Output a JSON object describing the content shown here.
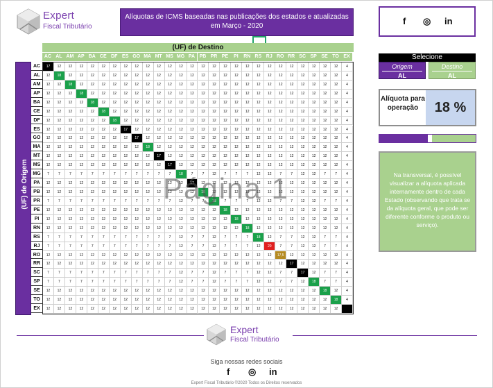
{
  "header": {
    "logo_title": "Expert",
    "logo_subtitle": "Fiscal Tributário",
    "title": "Alíquotas de ICMS baseadas nas publicações dos estados e atualizadas em Março - 2020"
  },
  "social": {
    "facebook": "f",
    "instagram": "◎",
    "linkedin": "in"
  },
  "table": {
    "dest_label": "(UF) de Destino",
    "orig_label": "(UF) de Origem",
    "states": [
      "AC",
      "AL",
      "AM",
      "AP",
      "BA",
      "CE",
      "DF",
      "ES",
      "GO",
      "MA",
      "MT",
      "MS",
      "MG",
      "PA",
      "PB",
      "PR",
      "PE",
      "PI",
      "RN",
      "RS",
      "RJ",
      "RO",
      "RR",
      "SC",
      "SP",
      "SE",
      "TO",
      "EX"
    ],
    "default_value": "12",
    "south_value": "7",
    "ex_value": "4",
    "diag_values": [
      "17",
      "18",
      "18",
      "18",
      "18",
      "18",
      "18",
      "17",
      "17",
      "18",
      "17",
      "17",
      "18",
      "17",
      "18",
      "18",
      "18",
      "18",
      "18",
      "18",
      "20",
      "17,5",
      "17",
      "17",
      "18",
      "18",
      "18",
      ""
    ],
    "south_rows": [
      "MG",
      "PR",
      "RS",
      "RJ",
      "SC",
      "SP"
    ],
    "watermark": "Página 1"
  },
  "panel": {
    "select_label": "Selecione",
    "origem_label": "Origem",
    "destino_label": "Destino",
    "origem_value": "AL",
    "destino_value": "AL",
    "aliquota_label": "Alíquota para operação",
    "aliquota_value": "18 %",
    "progress_fraction": 0.5,
    "note": "Na transversal, é possível visualizar a alíquota aplicada internamente dentro de cada Estado (observando que trata se da alíquota geral, que pode ser diferente conforme o produto ou serviço)."
  },
  "footer": {
    "logo_title": "Expert",
    "logo_subtitle": "Fiscal Tributário",
    "follow_text": "Siga nossas redes sociais",
    "copyright": "Expert Fiscal Tributário ©2020 Todos os Direitos reservados"
  },
  "colors": {
    "purple": "#6a2fa0",
    "green": "#a9d18e",
    "diag_green": "#1aa04a"
  }
}
